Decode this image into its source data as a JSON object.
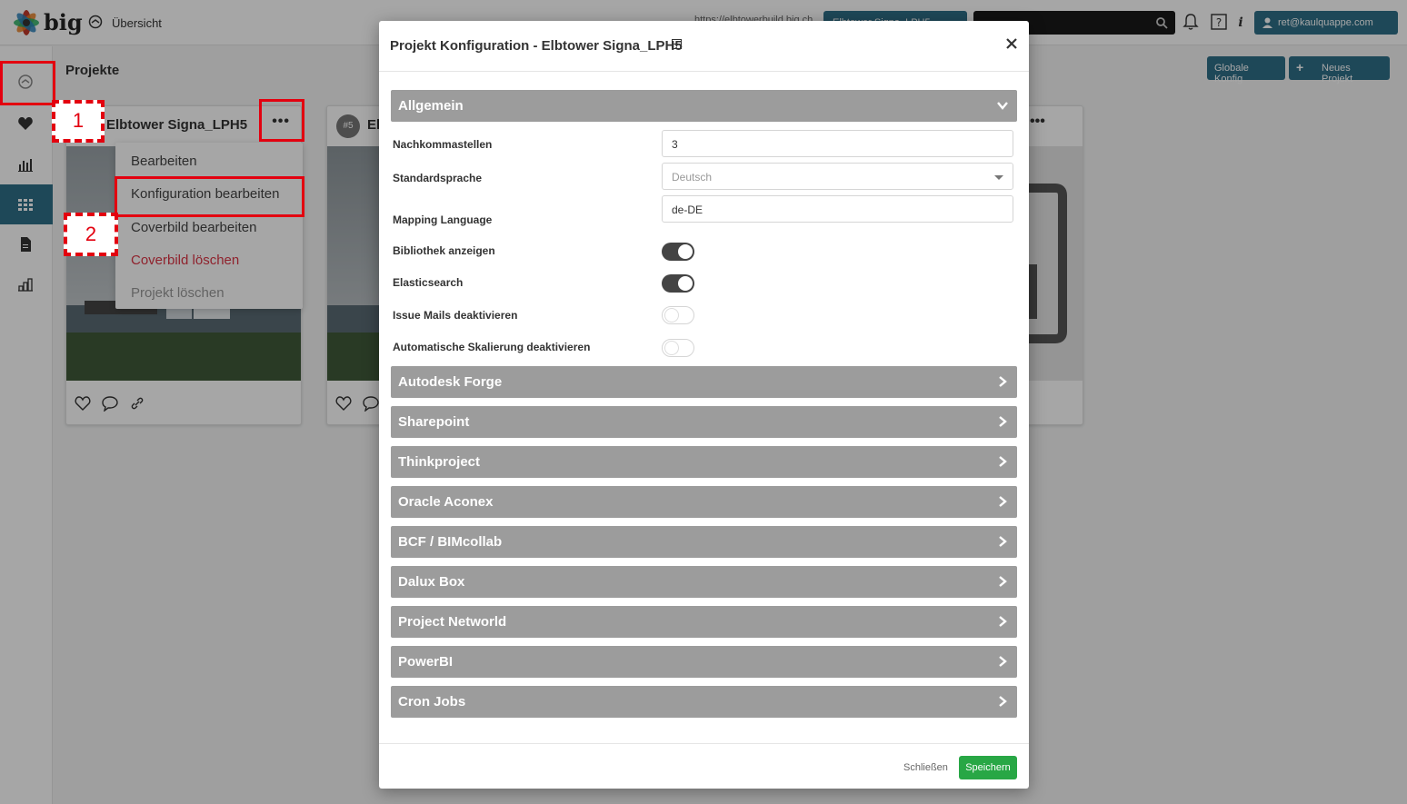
{
  "app": {
    "logo_text": "big",
    "nav_label": "Übersicht",
    "url_text": "https://elbtowerbuild.big.ch",
    "project_select": "Elbtower Signa_LPH5",
    "user_email": "ret@kaulquappe.com"
  },
  "page": {
    "title": "Projekte",
    "global_config_button": "Globale Konfig",
    "new_project_button": "Neues Projekt"
  },
  "cards": [
    {
      "title": "Elbtower Signa_LPH5",
      "badge": ""
    },
    {
      "title": "El",
      "badge": "#5"
    }
  ],
  "dropdown": {
    "items": [
      {
        "label": "Bearbeiten"
      },
      {
        "label": "Konfiguration bearbeiten"
      },
      {
        "label": "Coverbild bearbeiten"
      },
      {
        "label": "Coverbild löschen"
      },
      {
        "label": "Projekt löschen"
      }
    ]
  },
  "annotations": {
    "step1": "1",
    "step2": "2"
  },
  "modal": {
    "title": "Projekt Konfiguration - Elbtower Signa_LPH5",
    "general_section": "Allgemein",
    "fields": {
      "decimals_label": "Nachkommastellen",
      "decimals_value": "3",
      "language_label": "Standardsprache",
      "language_value": "Deutsch",
      "mapping_label": "Mapping Language",
      "mapping_value": "de-DE",
      "library_label": "Bibliothek anzeigen",
      "library_on": true,
      "elastic_label": "Elasticsearch",
      "elastic_on": true,
      "issue_mails_label": "Issue Mails deaktivieren",
      "issue_mails_on": false,
      "autoscale_label": "Automatische Skalierung deaktivieren",
      "autoscale_on": false
    },
    "sections": [
      "Autodesk Forge",
      "Sharepoint",
      "Thinkproject",
      "Oracle Aconex",
      "BCF / BIMcollab",
      "Dalux Box",
      "Project Networld",
      "PowerBI",
      "Cron Jobs"
    ],
    "footer": {
      "close_label": "Schließen",
      "save_label": "Speichern"
    }
  },
  "colors": {
    "primary": "#2f6f88",
    "section_bg": "#9c9c9c",
    "save": "#28a745",
    "danger": "#dc3545",
    "annotation": "#e3000f"
  }
}
